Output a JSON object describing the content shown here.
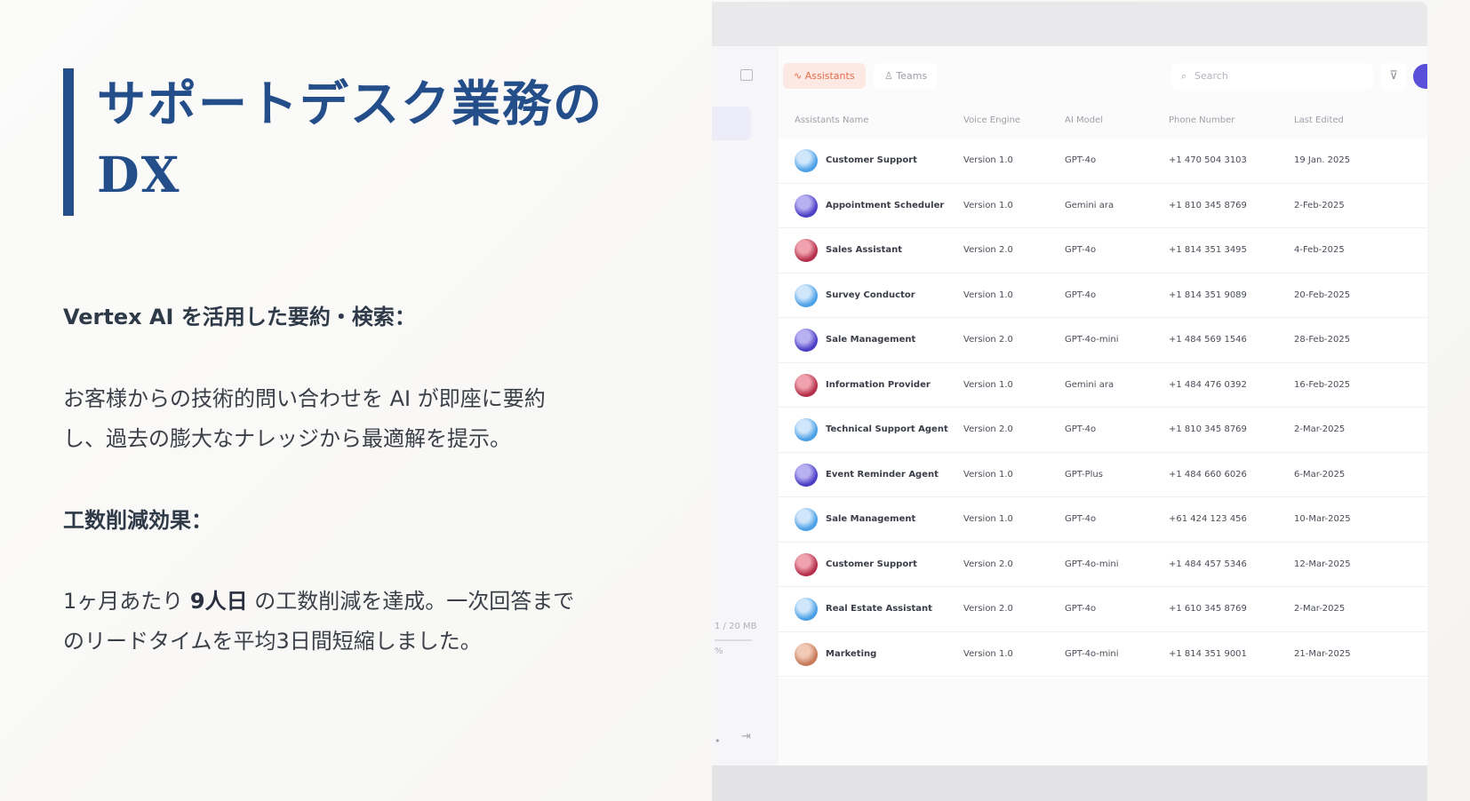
{
  "slide": {
    "title_line1": "サポートデスク業務の",
    "title_line2": "DX",
    "section1_heading": "Vertex AI を活用した要約・検索：",
    "section1_body_line1": "お客様からの技術的問い合わせを AI が即座に要約",
    "section1_body_line2": "し、過去の膨大なナレッジから最適解を提示。",
    "section2_heading": "工数削減効果：",
    "section2_pre": "1ヶ月あたり ",
    "section2_bold": "9人日",
    "section2_post": " の工数削減を達成。一次回答まで",
    "section2_line2": "のリードタイムを平均3日間短縮しました。"
  },
  "screenshot": {
    "tabs": [
      {
        "label": "Assistants",
        "icon": "wave-icon"
      },
      {
        "label": "Teams",
        "icon": "users-icon"
      }
    ],
    "search_placeholder": "Search",
    "columns": [
      "Assistants Name",
      "Voice Engine",
      "AI Model",
      "Phone Number",
      "Last Edited"
    ],
    "rows": [
      {
        "name": "Customer Support",
        "voice": "Version 1.0",
        "model": "GPT-4o",
        "phone": "+1 470 504 3103",
        "edited": "19 Jan. 2025",
        "avatar": "blue"
      },
      {
        "name": "Appointment Scheduler",
        "voice": "Version 1.0",
        "model": "Gemini ara",
        "phone": "+1 810 345 8769",
        "edited": "2-Feb-2025",
        "avatar": "purple"
      },
      {
        "name": "Sales Assistant",
        "voice": "Version 2.0",
        "model": "GPT-4o",
        "phone": "+1 814 351 3495",
        "edited": "4-Feb-2025",
        "avatar": "red"
      },
      {
        "name": "Survey Conductor",
        "voice": "Version 1.0",
        "model": "GPT-4o",
        "phone": "+1 814 351 9089",
        "edited": "20-Feb-2025",
        "avatar": "blue"
      },
      {
        "name": "Sale Management",
        "voice": "Version 2.0",
        "model": "GPT-4o-mini",
        "phone": "+1 484 569 1546",
        "edited": "28-Feb-2025",
        "avatar": "purple"
      },
      {
        "name": "Information Provider",
        "voice": "Version 1.0",
        "model": "Gemini ara",
        "phone": "+1 484 476 0392",
        "edited": "16-Feb-2025",
        "avatar": "red"
      },
      {
        "name": "Technical Support Agent",
        "voice": "Version 2.0",
        "model": "GPT-4o",
        "phone": "+1 810 345 8769",
        "edited": "2-Mar-2025",
        "avatar": "blue"
      },
      {
        "name": "Event Reminder Agent",
        "voice": "Version 1.0",
        "model": "GPT-Plus",
        "phone": "+1 484 660 6026",
        "edited": "6-Mar-2025",
        "avatar": "purple"
      },
      {
        "name": "Sale Management",
        "voice": "Version 1.0",
        "model": "GPT-4o",
        "phone": "+61 424 123 456",
        "edited": "10-Mar-2025",
        "avatar": "blue"
      },
      {
        "name": "Customer Support",
        "voice": "Version 2.0",
        "model": "GPT-4o-mini",
        "phone": "+1 484 457 5346",
        "edited": "12-Mar-2025",
        "avatar": "red"
      },
      {
        "name": "Real Estate Assistant",
        "voice": "Version 2.0",
        "model": "GPT-4o",
        "phone": "+1 610 345 8769",
        "edited": "2-Mar-2025",
        "avatar": "blue"
      },
      {
        "name": "Marketing",
        "voice": "Version 1.0",
        "model": "GPT-4o-mini",
        "phone": "+1 814 351 9001",
        "edited": "21-Mar-2025",
        "avatar": "tan"
      }
    ],
    "sidebar_version": "1 / 20 MB",
    "sidebar_small": "%",
    "sidebar_footer_dot": "•"
  }
}
